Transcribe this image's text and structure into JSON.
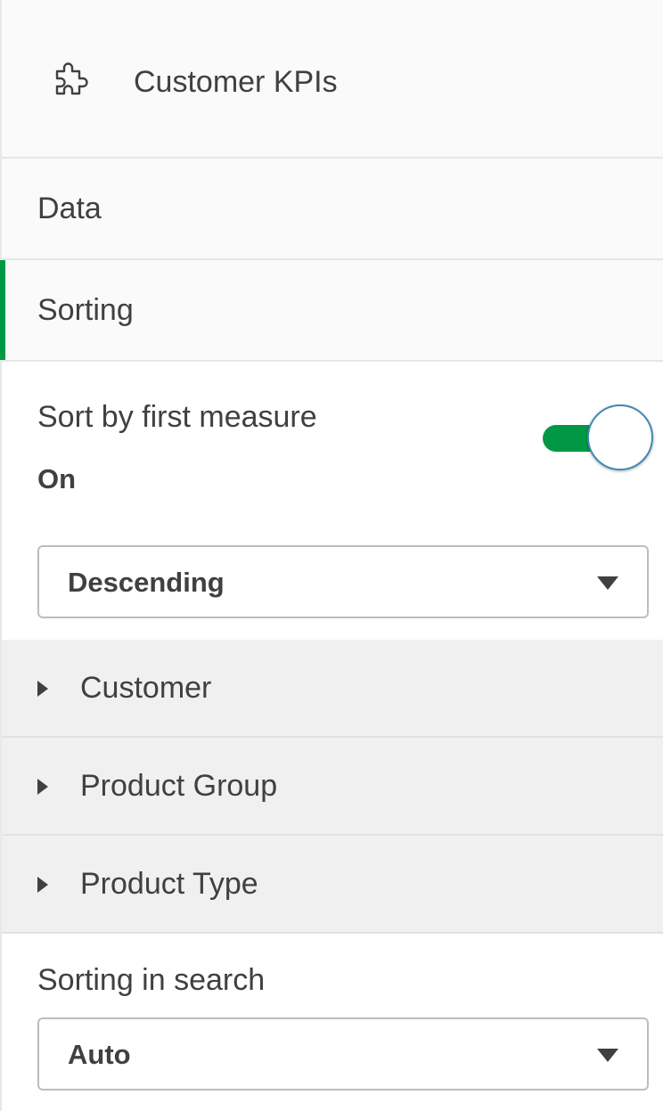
{
  "header": {
    "title": "Customer KPIs",
    "icon": "puzzle-extension-icon"
  },
  "nav": {
    "items": [
      {
        "label": "Data",
        "active": false
      },
      {
        "label": "Sorting",
        "active": true
      }
    ],
    "active_color": "#009845"
  },
  "sorting": {
    "sort_by_first_measure": {
      "label": "Sort by first measure",
      "state_label": "On",
      "enabled": true,
      "toggle_color": "#009845"
    },
    "order_select": {
      "value": "Descending"
    },
    "fields": [
      {
        "label": "Customer",
        "expanded": false
      },
      {
        "label": "Product Group",
        "expanded": false
      },
      {
        "label": "Product Type",
        "expanded": false
      }
    ],
    "sorting_in_search": {
      "label": "Sorting in search",
      "value": "Auto"
    }
  }
}
